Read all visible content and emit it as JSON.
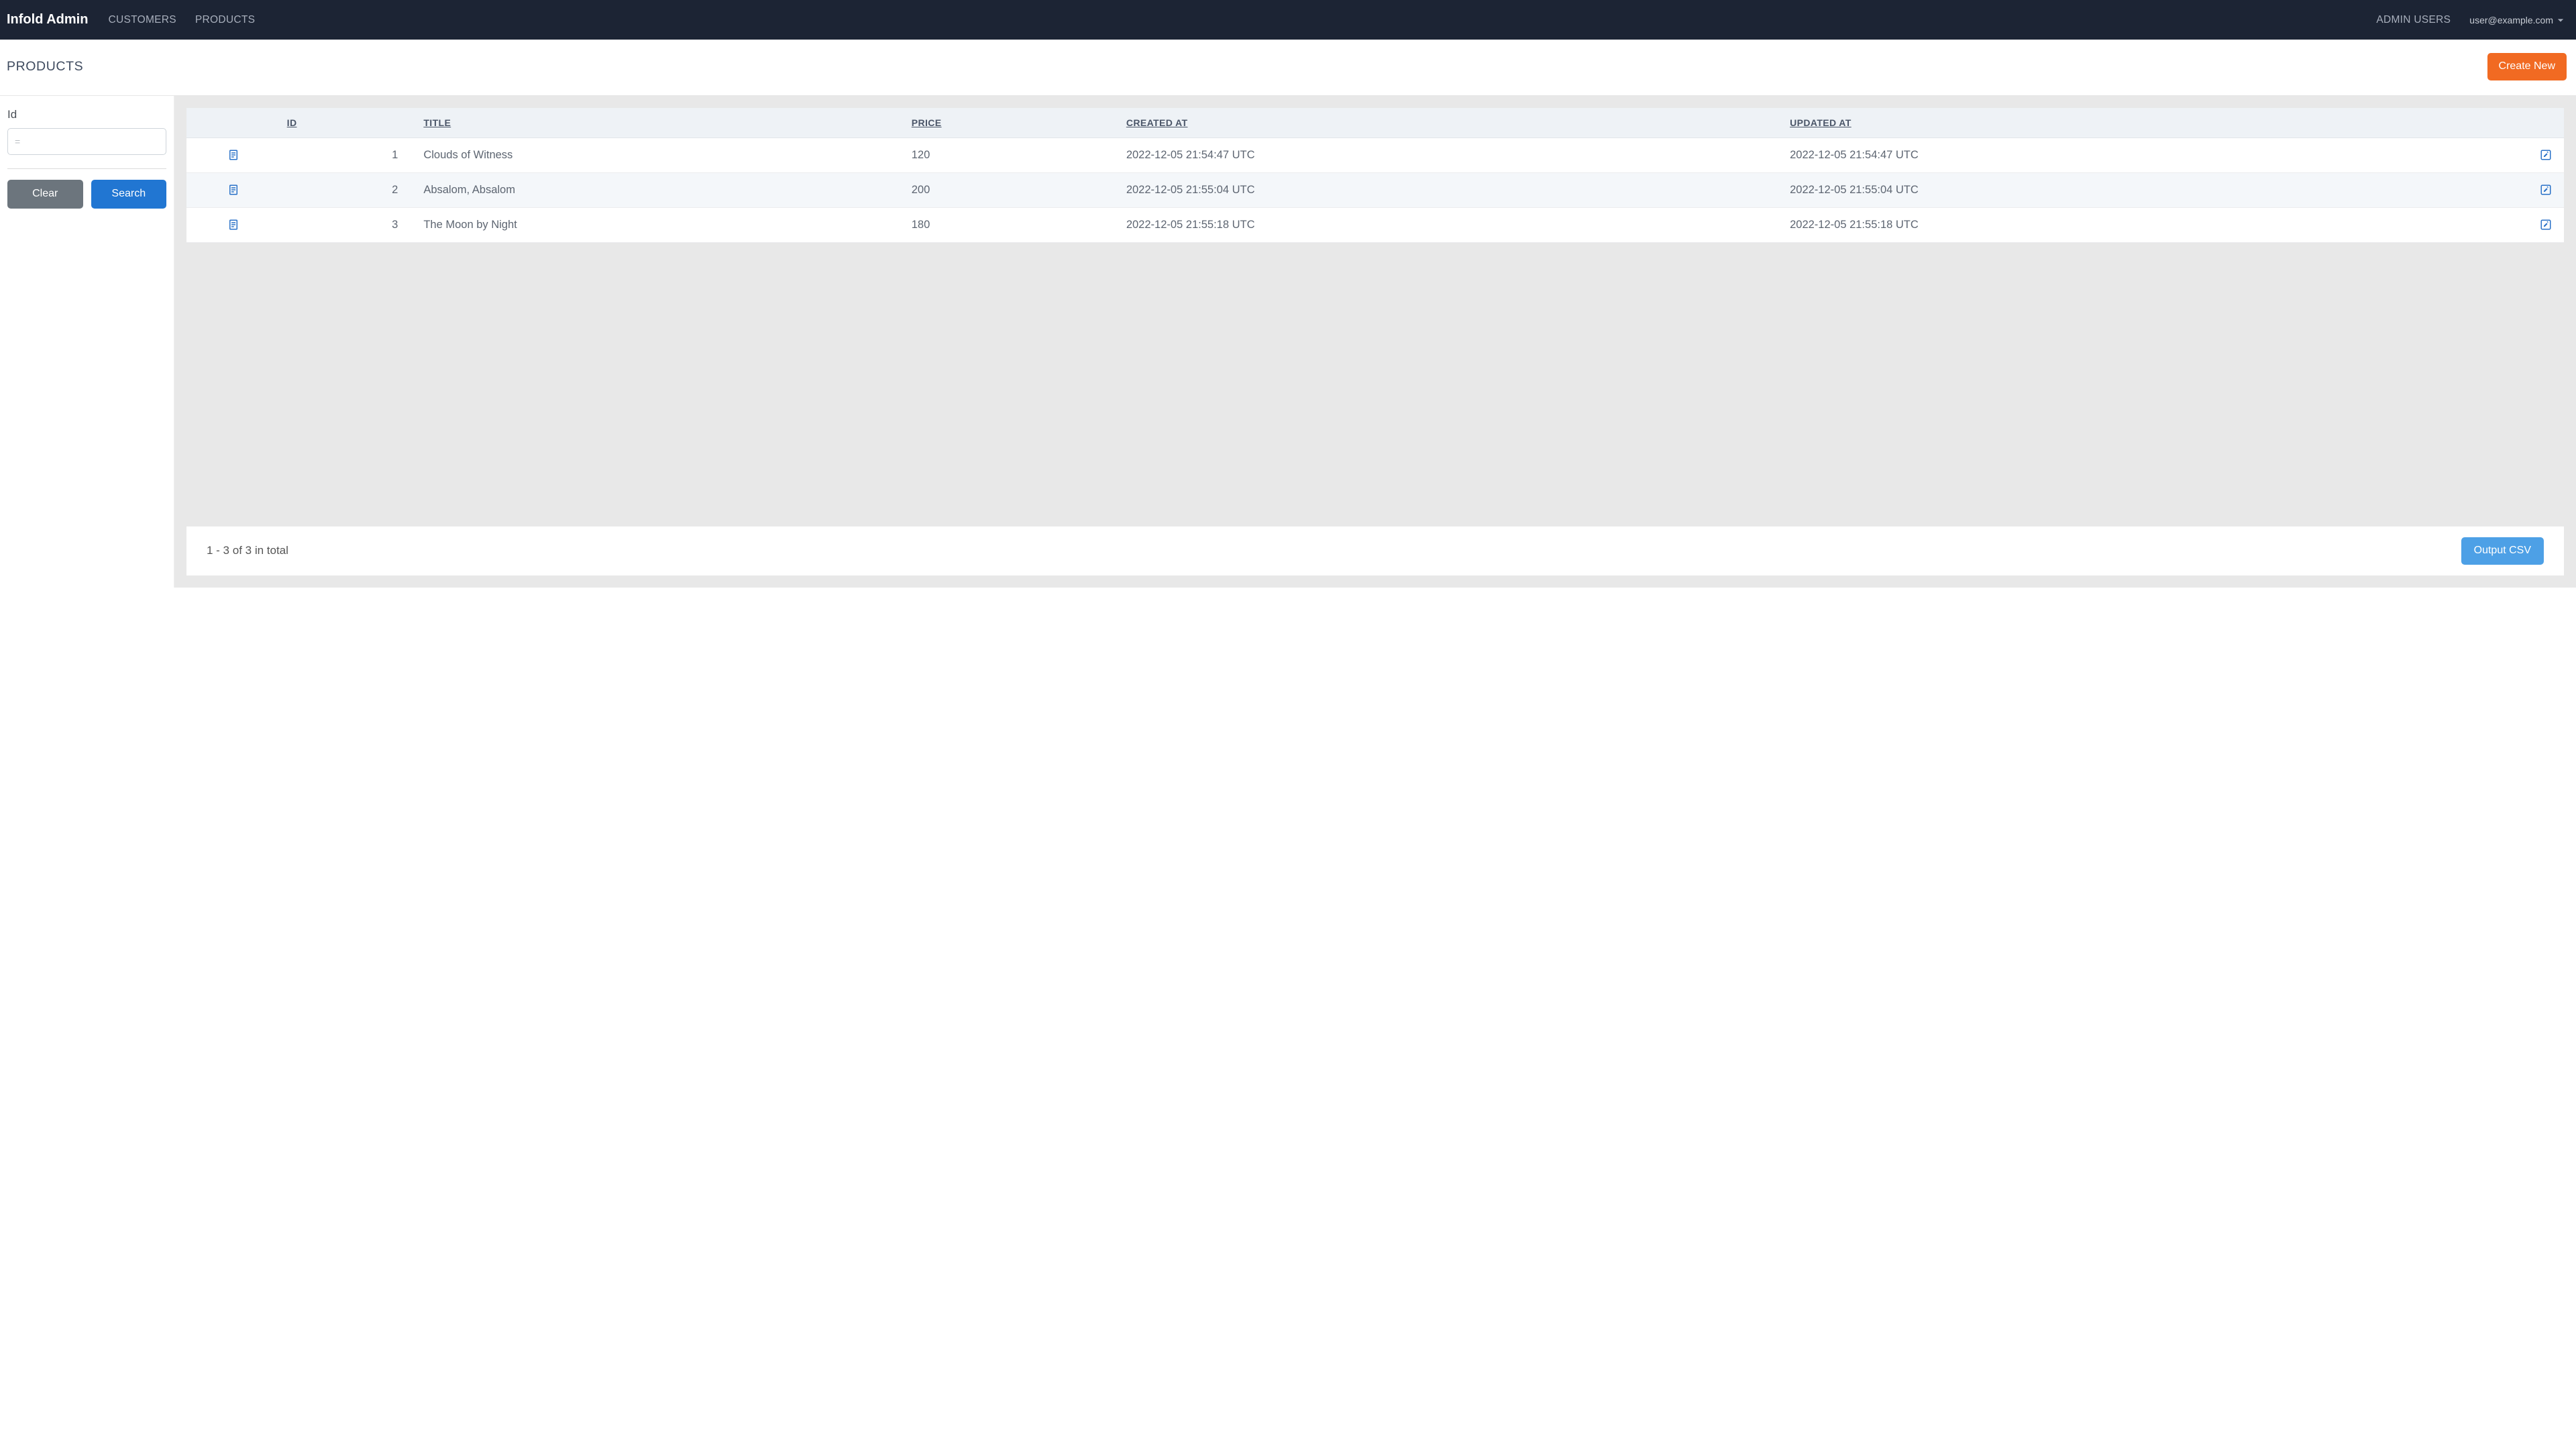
{
  "header": {
    "brand": "Infold Admin",
    "nav": {
      "customers": "CUSTOMERS",
      "products": "PRODUCTS",
      "admin_users": "ADMIN USERS"
    },
    "user_email": "user@example.com"
  },
  "page": {
    "title": "PRODUCTS",
    "create_label": "Create New"
  },
  "sidebar": {
    "id_label": "Id",
    "id_placeholder": "=",
    "clear_label": "Clear",
    "search_label": "Search"
  },
  "table": {
    "headers": {
      "id": "ID",
      "title": "TITLE",
      "price": "PRICE",
      "created_at": "CREATED AT",
      "updated_at": "UPDATED AT"
    },
    "rows": [
      {
        "id": "1",
        "title": "Clouds of Witness",
        "price": "120",
        "created_at": "2022-12-05 21:54:47 UTC",
        "updated_at": "2022-12-05 21:54:47 UTC"
      },
      {
        "id": "2",
        "title": "Absalom, Absalom",
        "price": "200",
        "created_at": "2022-12-05 21:55:04 UTC",
        "updated_at": "2022-12-05 21:55:04 UTC"
      },
      {
        "id": "3",
        "title": "The Moon by Night",
        "price": "180",
        "created_at": "2022-12-05 21:55:18 UTC",
        "updated_at": "2022-12-05 21:55:18 UTC"
      }
    ]
  },
  "footer": {
    "range_text": "1 - 3 of 3 in total",
    "export_label": "Output CSV"
  }
}
